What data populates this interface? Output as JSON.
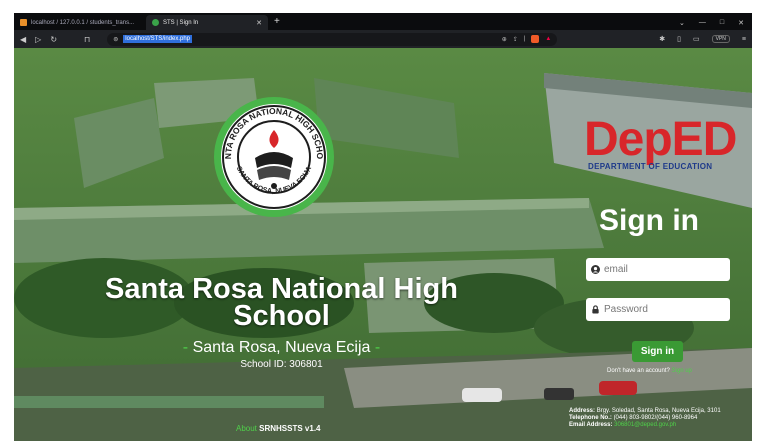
{
  "browser": {
    "tabs": [
      {
        "label": "localhost / 127.0.0.1 / students_trans...",
        "active": false
      },
      {
        "label": "STS | Sign In",
        "active": true
      }
    ],
    "new_tab": "+",
    "url": "localhost/STS/index.php",
    "vpn_label": "VPN"
  },
  "logo": {
    "deped_word": "DepED",
    "deped_sub": "DEPARTMENT OF EDUCATION",
    "seal_top": "SANTA ROSA NATIONAL HIGH SCHOOL",
    "seal_bottom": "SANTA ROSA, NUEVA ECIJA"
  },
  "school": {
    "name": "Santa Rosa National High School",
    "dash": "-",
    "location": "Santa Rosa, Nueva Ecija",
    "id_line": "School ID: 306801"
  },
  "signin": {
    "title": "Sign in",
    "email_placeholder": "email",
    "password_placeholder": "Password",
    "button": "Sign in",
    "no_account": "Don't have an account?",
    "signup_link": "Sign up"
  },
  "footer": {
    "about_link": "About",
    "version": "SRNHSSTS v1.4",
    "address_label": "Address:",
    "address": "Brgy. Soledad, Santa Rosa, Nueva Ecija, 3101",
    "phone_label": "Telephone No.:",
    "phone": "(044) 803-9802/(044) 960-8964",
    "email_label": "Email Address:",
    "email": "306801@deped.gov.ph"
  },
  "colors": {
    "accent_green": "#4fd04a",
    "button_green": "#3a9a34",
    "deped_red": "#d8262a",
    "deped_blue": "#1e3a8a"
  }
}
